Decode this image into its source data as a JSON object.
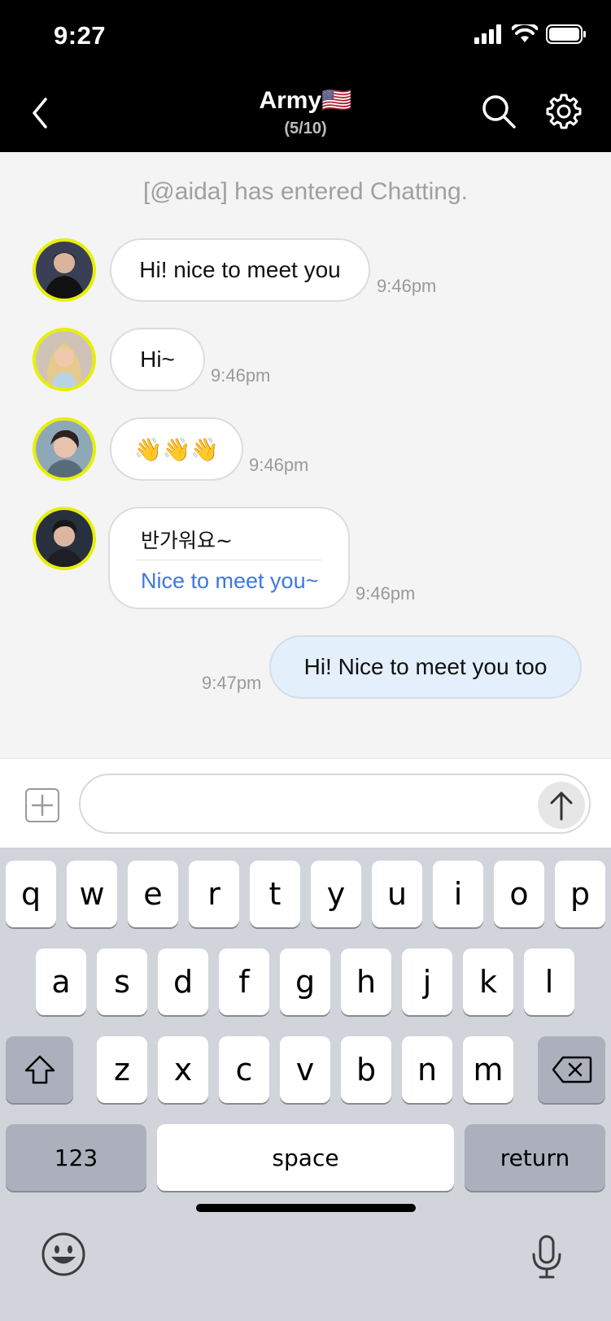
{
  "status": {
    "time": "9:27"
  },
  "header": {
    "title": "Army🇺🇸",
    "subtitle": "(5/10)"
  },
  "chat": {
    "system_message": "[@aida] has entered Chatting.",
    "messages": [
      {
        "text": "Hi! nice to meet you",
        "time": "9:46pm"
      },
      {
        "text": "Hi~",
        "time": "9:46pm"
      },
      {
        "text": "👋👋👋",
        "time": "9:46pm"
      },
      {
        "original": "반가워요~",
        "translation": "Nice to meet you~",
        "time": "9:46pm"
      }
    ],
    "my_message": {
      "text": "Hi! Nice to meet you too",
      "time": "9:47pm"
    }
  },
  "input": {
    "placeholder": ""
  },
  "keyboard": {
    "row1": [
      "q",
      "w",
      "e",
      "r",
      "t",
      "y",
      "u",
      "i",
      "o",
      "p"
    ],
    "row2": [
      "a",
      "s",
      "d",
      "f",
      "g",
      "h",
      "j",
      "k",
      "l"
    ],
    "row3": [
      "z",
      "x",
      "c",
      "v",
      "b",
      "n",
      "m"
    ],
    "numbers_label": "123",
    "space_label": "space",
    "return_label": "return"
  },
  "colors": {
    "header_bg": "#000000",
    "avatar_border": "#e6f000",
    "translation_text": "#3b78e0",
    "my_bubble": "#e3effb"
  }
}
